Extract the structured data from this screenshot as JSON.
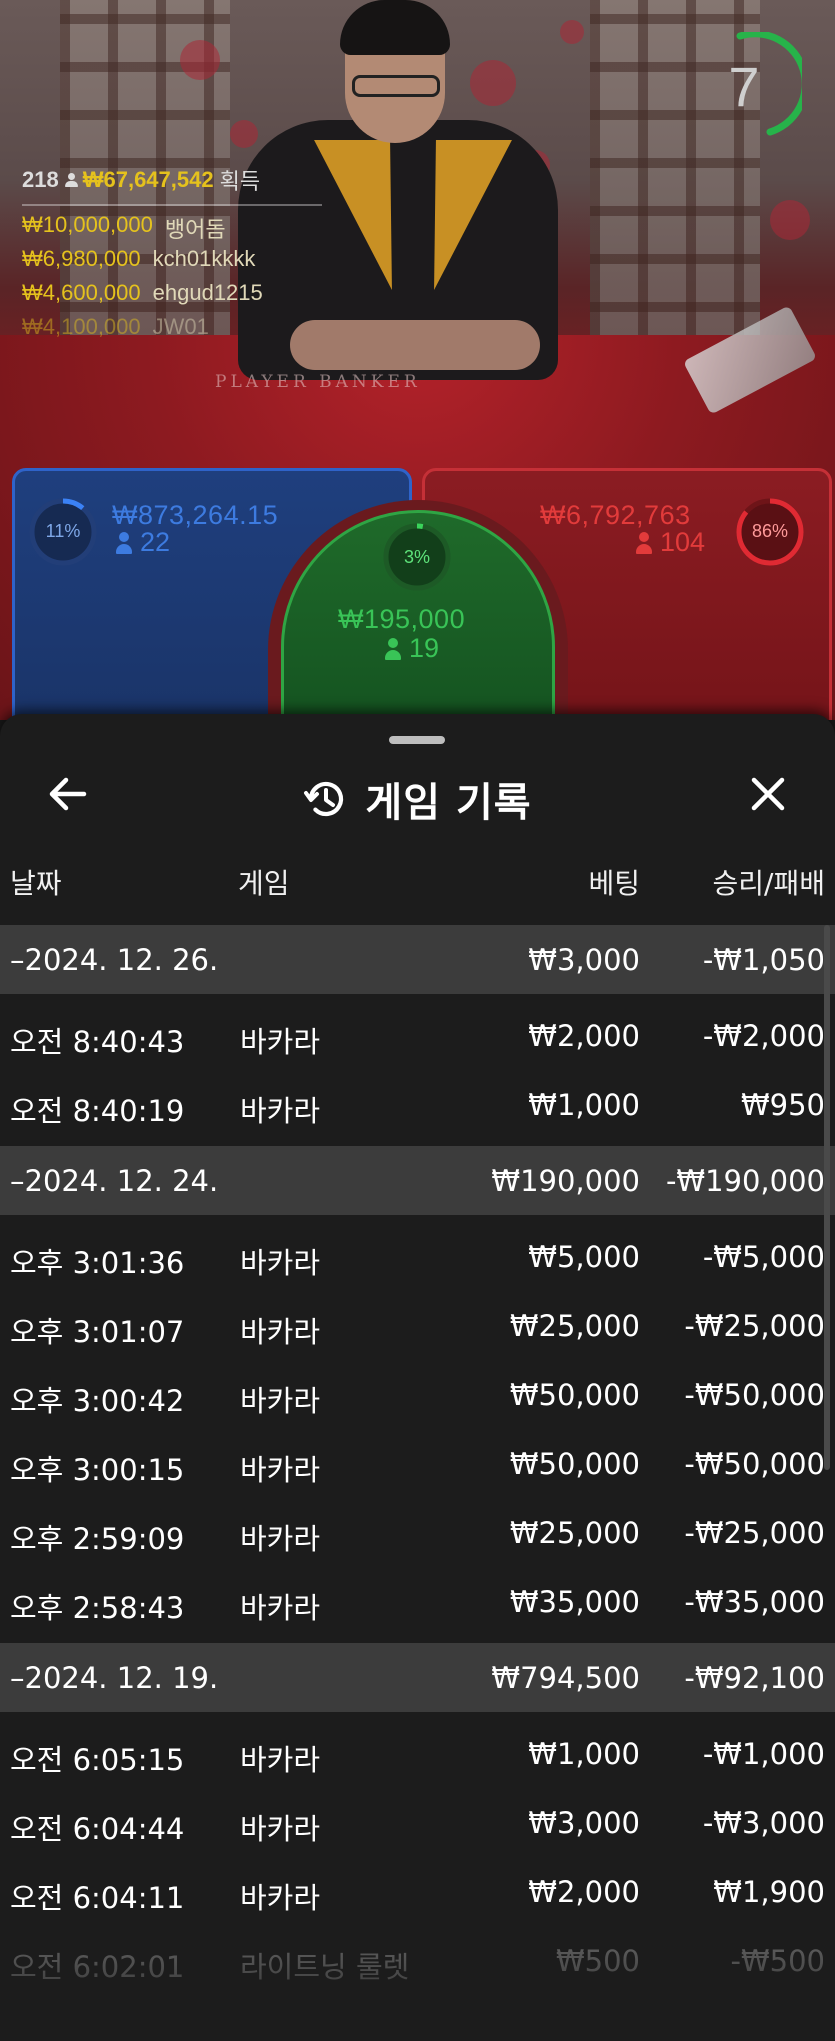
{
  "stream": {
    "timer": "7",
    "table_label": "PLAYER    BANKER",
    "winners": {
      "count": "218",
      "total": "₩67,647,542",
      "total_suffix": "획득",
      "rows": [
        {
          "amount": "₩10,000,000",
          "name": "뱅어돔"
        },
        {
          "amount": "₩6,980,000",
          "name": "kch01kkkk"
        },
        {
          "amount": "₩4,600,000",
          "name": "ehgud1215"
        },
        {
          "amount": "₩4,100,000",
          "name": "JW01"
        }
      ]
    },
    "spots": {
      "player": {
        "percent": "11%",
        "amount": "₩873,264.15",
        "players": "22",
        "percent_value": 11,
        "color": "#2f63c9"
      },
      "tie": {
        "percent": "3%",
        "amount": "₩195,000",
        "players": "19",
        "percent_value": 3,
        "color": "#2fa544"
      },
      "banker": {
        "percent": "86%",
        "amount": "₩6,792,763",
        "players": "104",
        "percent_value": 86,
        "color": "#e02a33"
      }
    }
  },
  "sheet": {
    "title": "게임 기록",
    "icons": {
      "back": "arrow-left-icon",
      "history": "history-icon",
      "close": "close-icon"
    },
    "columns": {
      "date": "날짜",
      "game": "게임",
      "bet": "베팅",
      "result": "승리/패배"
    },
    "rows": [
      {
        "type": "group",
        "date": "–2024. 12. 26.",
        "bet": "₩3,000",
        "result": "-₩1,050"
      },
      {
        "type": "item",
        "date": "오전 8:40:43",
        "game": "바카라",
        "bet": "₩2,000",
        "result": "-₩2,000"
      },
      {
        "type": "item",
        "date": "오전 8:40:19",
        "game": "바카라",
        "bet": "₩1,000",
        "result": "₩950"
      },
      {
        "type": "group",
        "date": "–2024. 12. 24.",
        "bet": "₩190,000",
        "result": "-₩190,000"
      },
      {
        "type": "item",
        "date": "오후 3:01:36",
        "game": "바카라",
        "bet": "₩5,000",
        "result": "-₩5,000"
      },
      {
        "type": "item",
        "date": "오후 3:01:07",
        "game": "바카라",
        "bet": "₩25,000",
        "result": "-₩25,000"
      },
      {
        "type": "item",
        "date": "오후 3:00:42",
        "game": "바카라",
        "bet": "₩50,000",
        "result": "-₩50,000"
      },
      {
        "type": "item",
        "date": "오후 3:00:15",
        "game": "바카라",
        "bet": "₩50,000",
        "result": "-₩50,000"
      },
      {
        "type": "item",
        "date": "오후 2:59:09",
        "game": "바카라",
        "bet": "₩25,000",
        "result": "-₩25,000"
      },
      {
        "type": "item",
        "date": "오후 2:58:43",
        "game": "바카라",
        "bet": "₩35,000",
        "result": "-₩35,000"
      },
      {
        "type": "group",
        "date": "–2024. 12. 19.",
        "bet": "₩794,500",
        "result": "-₩92,100"
      },
      {
        "type": "item",
        "date": "오전 6:05:15",
        "game": "바카라",
        "bet": "₩1,000",
        "result": "-₩1,000"
      },
      {
        "type": "item",
        "date": "오전 6:04:44",
        "game": "바카라",
        "bet": "₩3,000",
        "result": "-₩3,000"
      },
      {
        "type": "item",
        "date": "오전 6:04:11",
        "game": "바카라",
        "bet": "₩2,000",
        "result": "₩1,900"
      },
      {
        "type": "item",
        "date": "오전 6:02:01",
        "game": "라이트닝 룰렛",
        "bet": "₩500",
        "result": "-₩500",
        "faded": true
      }
    ]
  }
}
